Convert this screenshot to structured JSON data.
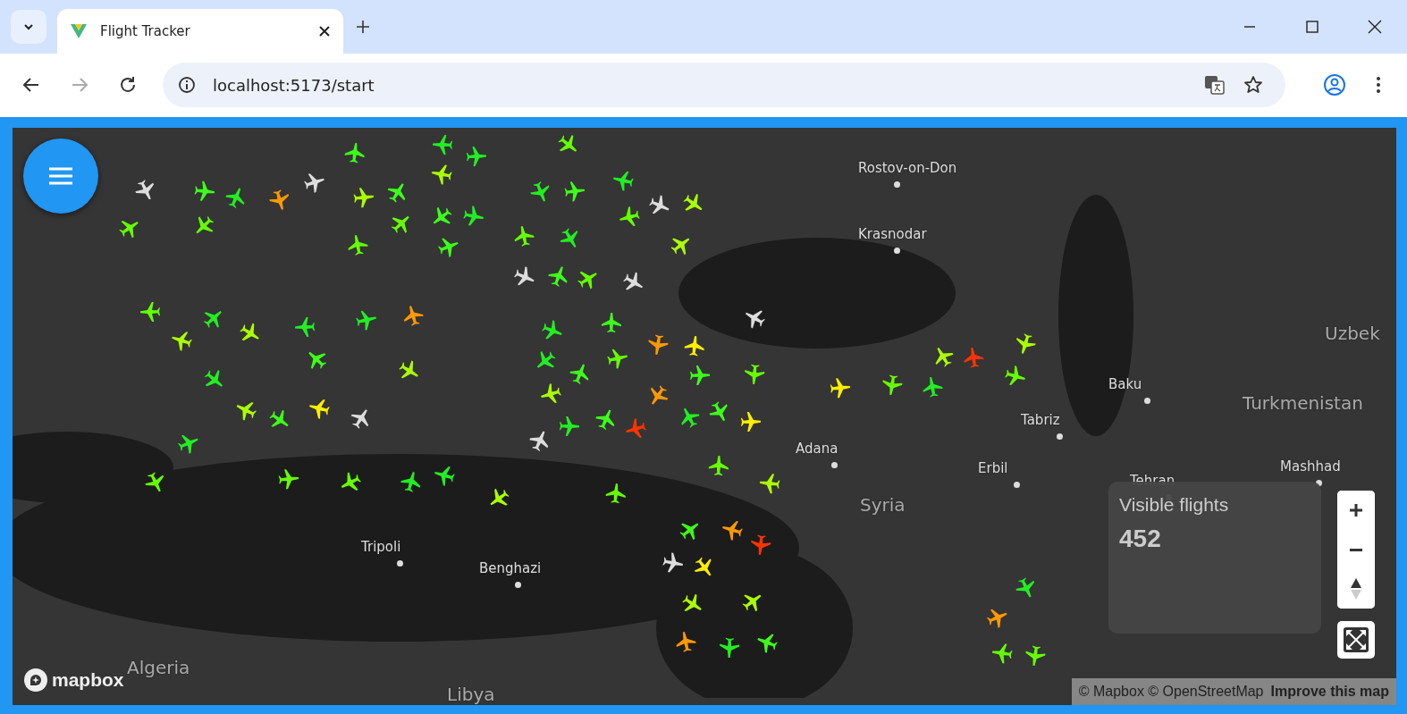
{
  "browser": {
    "tab_title": "Flight Tracker",
    "url": "localhost:5173/start"
  },
  "map": {
    "labels": [
      {
        "text": "Rostov-on-Don",
        "kind": "city"
      },
      {
        "text": "Krasnodar",
        "kind": "city"
      },
      {
        "text": "Baku",
        "kind": "city"
      },
      {
        "text": "Uzbek",
        "kind": "country"
      },
      {
        "text": "Turkmenistan",
        "kind": "country"
      },
      {
        "text": "Tabriz",
        "kind": "city"
      },
      {
        "text": "Adana",
        "kind": "city"
      },
      {
        "text": "Erbil",
        "kind": "city"
      },
      {
        "text": "Mashhad",
        "kind": "city"
      },
      {
        "text": "Tehran",
        "kind": "city"
      },
      {
        "text": "Syria",
        "kind": "country"
      },
      {
        "text": "Tripoli",
        "kind": "city"
      },
      {
        "text": "Benghazi",
        "kind": "city"
      },
      {
        "text": "Algeria",
        "kind": "country"
      },
      {
        "text": "Libya",
        "kind": "country"
      }
    ],
    "info_panel": {
      "title": "Visible flights",
      "count": "452"
    },
    "logo": "mapbox",
    "attribution": {
      "text": "© Mapbox © OpenStreetMap",
      "link": "Improve this map"
    }
  }
}
